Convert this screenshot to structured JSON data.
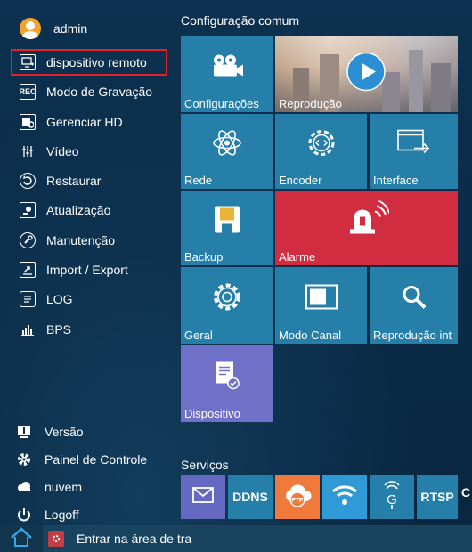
{
  "user": {
    "name": "admin"
  },
  "menu": [
    {
      "label": "dispositivo remoto",
      "icon": "monitor-plus-icon",
      "active": true
    },
    {
      "label": "Modo de Gravação",
      "icon": "rec-icon"
    },
    {
      "label": "Gerenciar HD",
      "icon": "hdd-gear-icon"
    },
    {
      "label": "Vídeo",
      "icon": "sliders-icon"
    },
    {
      "label": "Restaurar",
      "icon": "restore-icon"
    },
    {
      "label": "Atualização",
      "icon": "upgrade-icon"
    },
    {
      "label": "Manutenção",
      "icon": "maintenance-icon"
    },
    {
      "label": "Import / Export",
      "icon": "import-export-icon"
    },
    {
      "label": "LOG",
      "icon": "log-icon"
    },
    {
      "label": "BPS",
      "icon": "bps-chart-icon"
    }
  ],
  "bottom_menu": [
    {
      "label": "Versão",
      "icon": "info-icon"
    },
    {
      "label": "Painel de Controle",
      "icon": "gear-icon"
    },
    {
      "label": "nuvem",
      "icon": "cloud-icon"
    },
    {
      "label": "Logoff",
      "icon": "power-icon"
    }
  ],
  "sections": {
    "common": "Configuração comum",
    "services": "Serviços"
  },
  "tiles": {
    "configuracoes": "Configurações",
    "reproducao": "Reprodução",
    "rede": "Rede",
    "encoder": "Encoder",
    "interface": "Interface",
    "backup": "Backup",
    "alarme": "Alarme",
    "geral": "Geral",
    "modo_canal": "Modo Canal",
    "reproducao_int": "Reprodução int",
    "dispositivo": "Dispositivo"
  },
  "services": {
    "ddns": "DDNS",
    "ftp": "FTP",
    "rtsp": "RTSP"
  },
  "taskbar": {
    "label": "Entrar na área de tra"
  },
  "colors": {
    "tile_blue": "#267fa9",
    "tile_red": "#d12c40",
    "tile_purple": "#6f71c9",
    "active_border": "#e0232a",
    "background": "#0b2d48"
  }
}
